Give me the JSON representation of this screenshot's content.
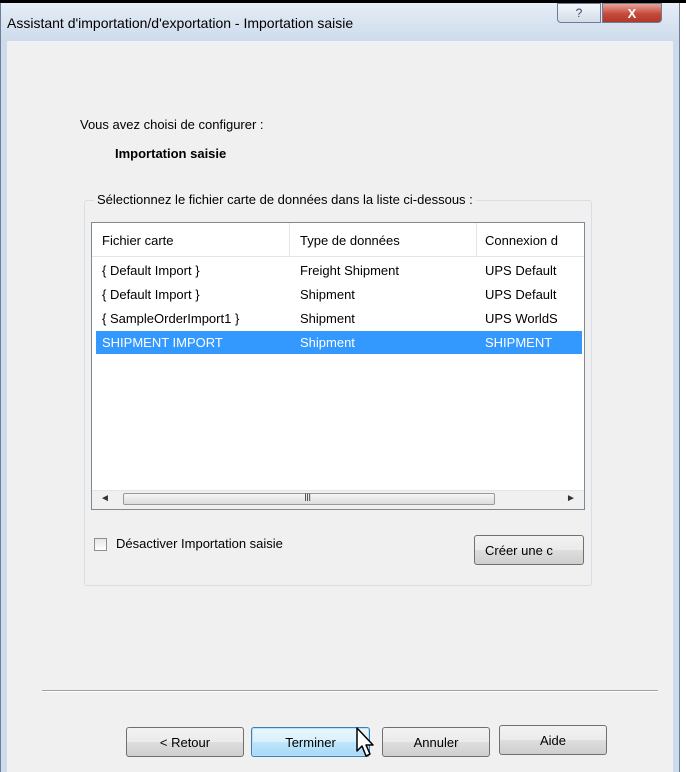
{
  "window": {
    "title": "Assistant d'importation/d'exportation - Importation saisie",
    "help_glyph": "?",
    "close_glyph": "X"
  },
  "intro": {
    "text": "Vous avez choisi de configurer :",
    "selection": "Importation saisie"
  },
  "group": {
    "label": "Sélectionnez le fichier carte de données dans la liste ci-dessous :"
  },
  "list": {
    "columns": [
      "Fichier carte",
      "Type de données",
      "Connexion d"
    ],
    "rows": [
      [
        "{ Default Import }",
        "Freight Shipment",
        "UPS Default"
      ],
      [
        "{ Default Import }",
        "Shipment",
        "UPS Default"
      ],
      [
        "{ SampleOrderImport1 }",
        "Shipment",
        "UPS WorldS"
      ],
      [
        "SHIPMENT IMPORT",
        "Shipment",
        "SHIPMENT"
      ]
    ],
    "selected_row": 3,
    "scroll": {
      "left_arrow": "◄",
      "right_arrow": "►",
      "grip": "III"
    }
  },
  "options": {
    "disable_label": "Désactiver Importation saisie",
    "disable_checked": false,
    "create_button": "Créer une c"
  },
  "footer": {
    "back": "< Retour",
    "finish": "Terminer",
    "cancel": "Annuler",
    "help": "Aide"
  }
}
